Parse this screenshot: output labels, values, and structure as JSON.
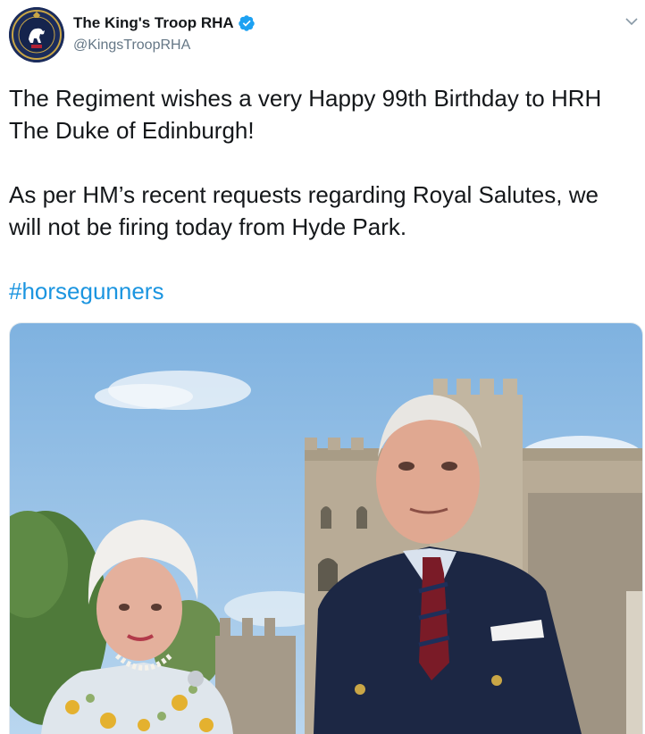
{
  "tweet": {
    "display_name": "The King's Troop RHA",
    "handle": "@KingsTroopRHA",
    "verified": true,
    "paragraphs": [
      "The Regiment wishes a very Happy 99th Birthday to HRH The Duke of Edinburgh!",
      "As per HM’s recent requests regarding Royal Salutes, we will not be firing today from Hyde Park."
    ],
    "hashtag": "#horsegunners",
    "icons": {
      "avatar": "regiment-crest-avatar",
      "verified": "verified-badge-icon",
      "menu": "chevron-down-icon"
    },
    "colors": {
      "link": "#1b95e0",
      "handle": "#657786",
      "text": "#14171a",
      "verified": "#1da1f2"
    }
  }
}
